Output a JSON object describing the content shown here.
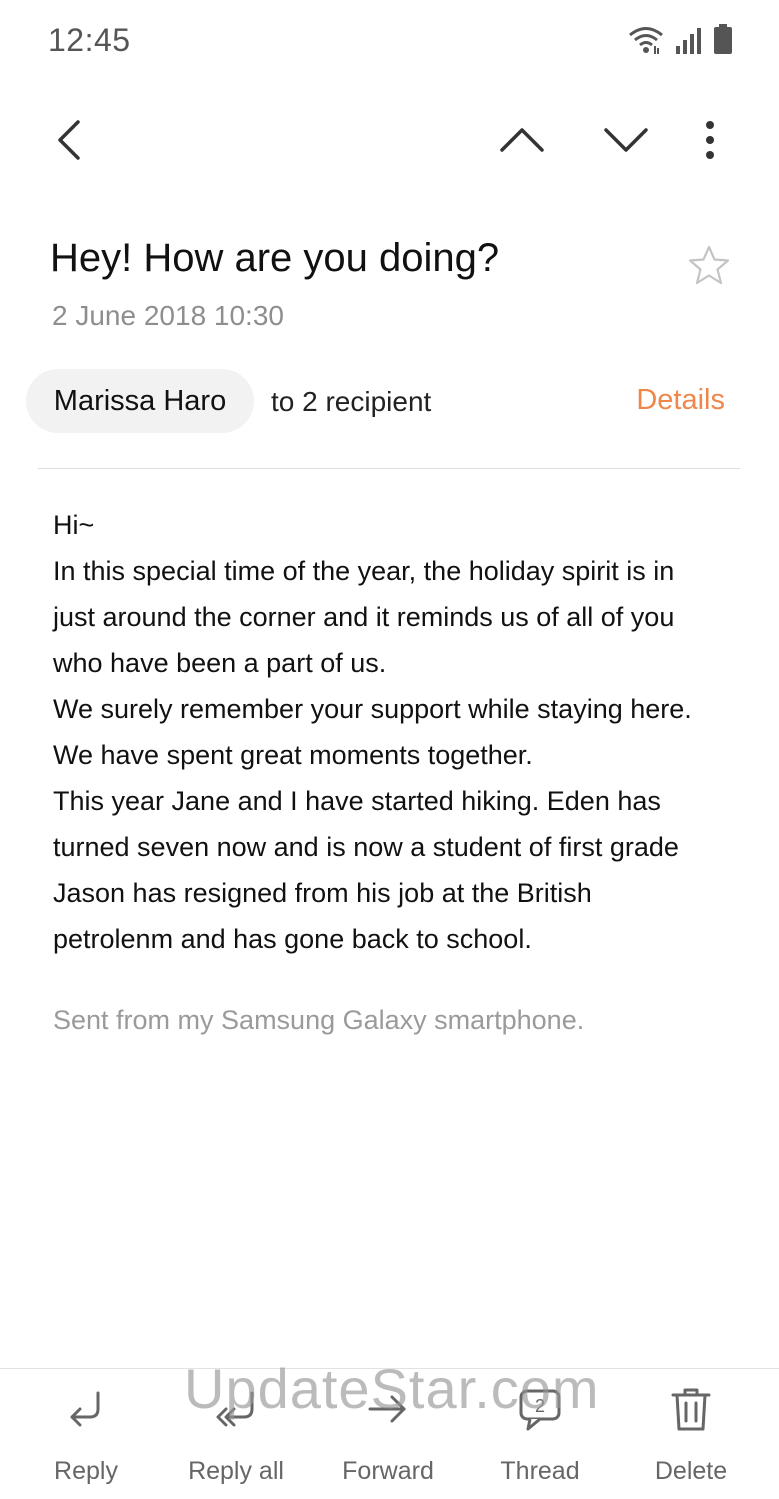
{
  "status_bar": {
    "time": "12:45",
    "icons": [
      "wifi-icon",
      "signal-icon",
      "battery-icon"
    ]
  },
  "toolbar": {
    "icons": [
      "back-arrow-icon",
      "chevron-up-icon",
      "chevron-down-icon",
      "more-vertical-icon"
    ]
  },
  "email": {
    "subject": "Hey! How are you doing?",
    "date": "2 June 2018 10:30",
    "sender": "Marissa Haro",
    "recipients_text": "to 2 recipient",
    "details_label": "Details",
    "body_lines": [
      "Hi~",
      "In this special time of the year, the holiday spirit is in",
      "just around the corner and it reminds us of all of you",
      "who have been a part of us.",
      "We surely remember your support while staying here.",
      "We have spent great moments together.",
      "This year Jane and I have started hiking. Eden has",
      "turned seven now and is now a student of first grade",
      "Jason has resigned from his job at the British",
      "petrolenm and has gone back to school."
    ],
    "signature": "Sent from my Samsung Galaxy smartphone."
  },
  "bottom_actions": [
    {
      "label": "Reply",
      "icon": "reply-icon"
    },
    {
      "label": "Reply all",
      "icon": "reply-all-icon"
    },
    {
      "label": "Forward",
      "icon": "forward-icon"
    },
    {
      "label": "Thread",
      "icon": "thread-icon",
      "badge": "2"
    },
    {
      "label": "Delete",
      "icon": "trash-icon"
    }
  ],
  "watermark": "UpdateStar.com",
  "colors": {
    "accent": "#f0874a",
    "muted_text": "#8e8e8e",
    "chip_bg": "#f2f2f2"
  }
}
